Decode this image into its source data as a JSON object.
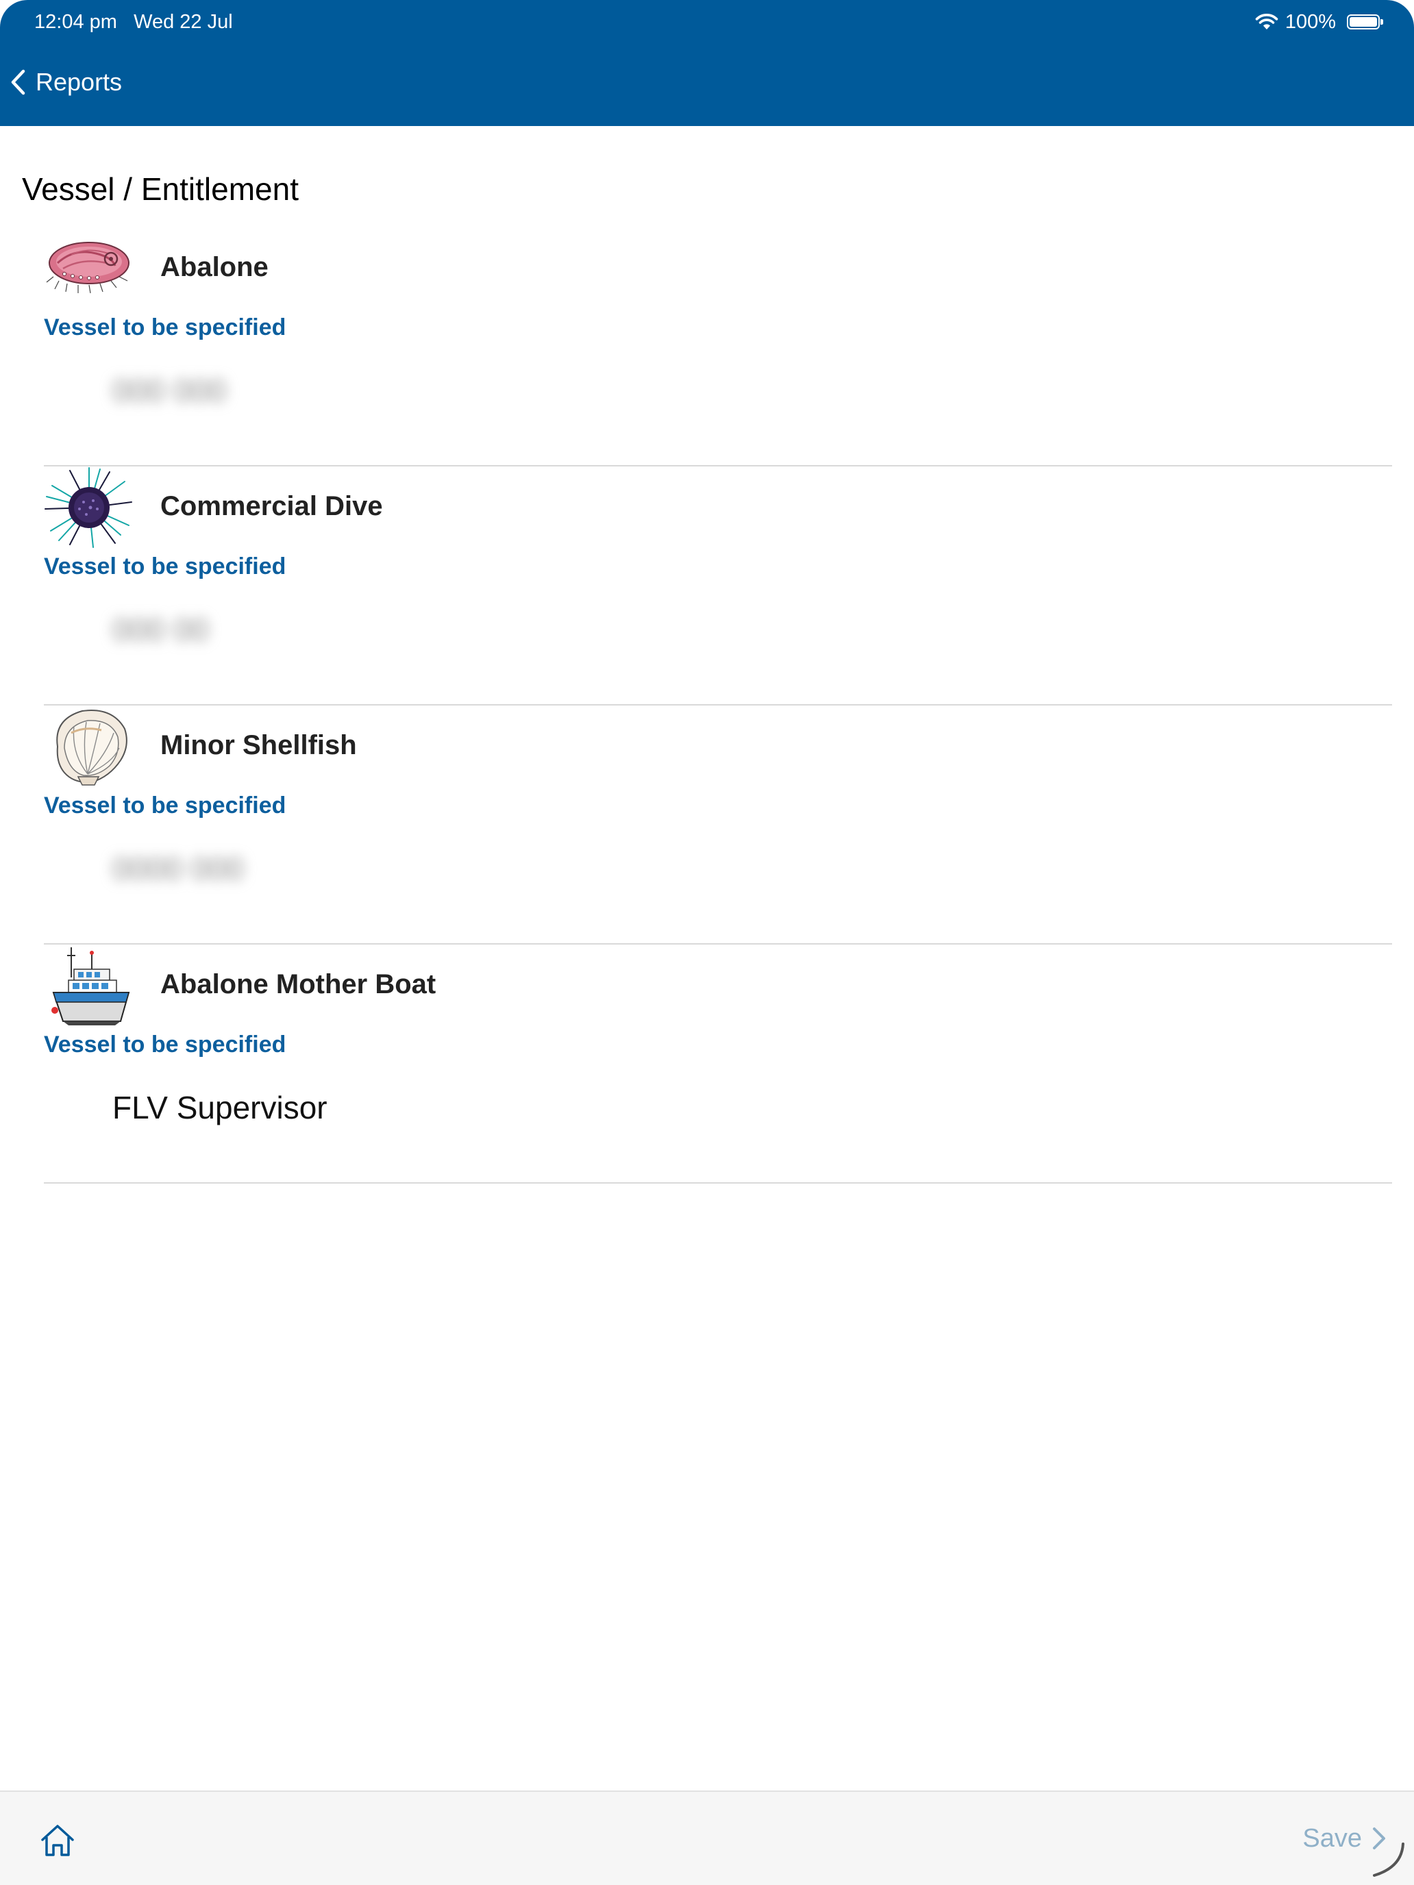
{
  "status_bar": {
    "time": "12:04 pm",
    "date": "Wed 22 Jul",
    "battery": "100%"
  },
  "nav": {
    "back_label": "Reports"
  },
  "page": {
    "title": "Vessel / Entitlement"
  },
  "entitlements": [
    {
      "name": "Abalone",
      "icon": "abalone-icon",
      "status": "Vessel to be specified",
      "vessel": "000 000",
      "vessel_obscured": true
    },
    {
      "name": "Commercial Dive",
      "icon": "sea-urchin-icon",
      "status": "Vessel to be specified",
      "vessel": "000 00",
      "vessel_obscured": true
    },
    {
      "name": "Minor Shellfish",
      "icon": "scallop-shell-icon",
      "status": "Vessel to be specified",
      "vessel": "0000 000",
      "vessel_obscured": true
    },
    {
      "name": "Abalone Mother Boat",
      "icon": "boat-icon",
      "status": "Vessel to be specified",
      "vessel": "FLV Supervisor",
      "vessel_obscured": false
    }
  ],
  "footer": {
    "home_icon": "home-icon",
    "save_label": "Save"
  },
  "colors": {
    "header_bg": "#005a9a",
    "accent_text": "#0d5f9e",
    "save_disabled": "#8fb0c8",
    "footer_bg": "#f6f6f6"
  }
}
